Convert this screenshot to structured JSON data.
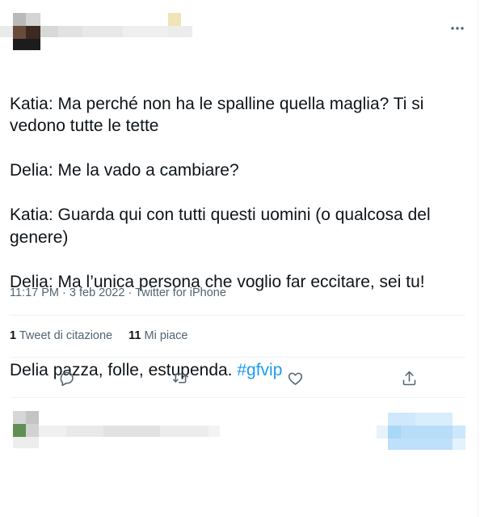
{
  "tweet": {
    "lines": [
      "Katia: Ma perché non ha le spalline quella maglia? Ti si vedono tutte le tette",
      "Delia: Me la vado a cambiare?",
      "Katia: Guarda qui con tutti questi uomini (o qualcosa del genere)",
      "Delia: Ma l’unica persona che voglio far eccitare, sei tu!"
    ],
    "closing": "Delia pazza, folle, estupenda. ",
    "hashtag": "#gfvip"
  },
  "meta": {
    "time": "11:17 PM",
    "sep1": " · ",
    "date": "3 feb 2022",
    "sep2": " · ",
    "source": "Twitter for iPhone"
  },
  "stats": {
    "quotes_count": "1",
    "quotes_label": "Tweet di citazione",
    "likes_count": "11",
    "likes_label": "Mi piace"
  },
  "icons": {
    "more": "more-horizontal-icon",
    "reply": "reply-icon",
    "retweet": "retweet-icon",
    "like": "heart-icon",
    "share": "share-icon"
  },
  "colors": {
    "text": "#0f1419",
    "secondary": "#536471",
    "link": "#1d9bf0",
    "divider": "#eff3f4"
  }
}
